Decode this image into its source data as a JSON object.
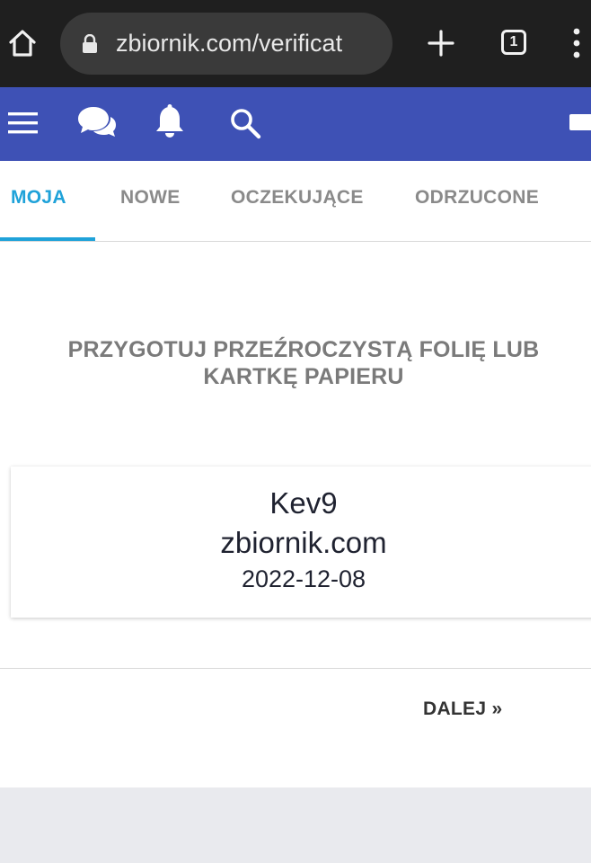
{
  "browser": {
    "url": "zbiornik.com/verificat",
    "tab_count": "1"
  },
  "tabs": [
    {
      "label": "MOJA",
      "active": true
    },
    {
      "label": "NOWE",
      "active": false
    },
    {
      "label": "OCZEKUJĄCE",
      "active": false
    },
    {
      "label": "ODRZUCONE",
      "active": false
    }
  ],
  "instruction": {
    "line1": "PRZYGOTUJ PRZEŹROCZYSTĄ FOLIĘ LUB",
    "line2": "KARTKĘ PAPIERU"
  },
  "card": {
    "username": "Kev9",
    "site": "zbiornik.com",
    "date": "2022-12-08"
  },
  "next_label": "DALEJ »",
  "icons": {
    "home": "home-icon",
    "lock": "lock-icon",
    "new_tab": "plus-icon",
    "menu": "hamburger-menu-icon",
    "chat": "chat-bubbles-icon",
    "bell": "bell-icon",
    "search": "search-icon",
    "kebab": "kebab-menu-icon"
  },
  "colors": {
    "appbar": "#3e51b5",
    "accent": "#1fa2d9",
    "chrome": "#1f1f1f"
  }
}
